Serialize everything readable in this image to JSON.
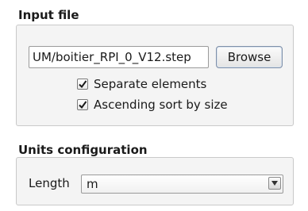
{
  "input_file": {
    "title": "Input file",
    "path_value": "UM/boitier_RPI_0_V12.step",
    "browse_label": "Browse",
    "separate_elements_label": "Separate elements",
    "separate_elements_checked": true,
    "ascending_sort_label": "Ascending sort by size",
    "ascending_sort_checked": true
  },
  "units": {
    "title": "Units configuration",
    "length_label": "Length",
    "length_value": "m"
  },
  "icons": {
    "checkmark": "checkmark-icon",
    "dropdown": "chevron-down-icon"
  }
}
